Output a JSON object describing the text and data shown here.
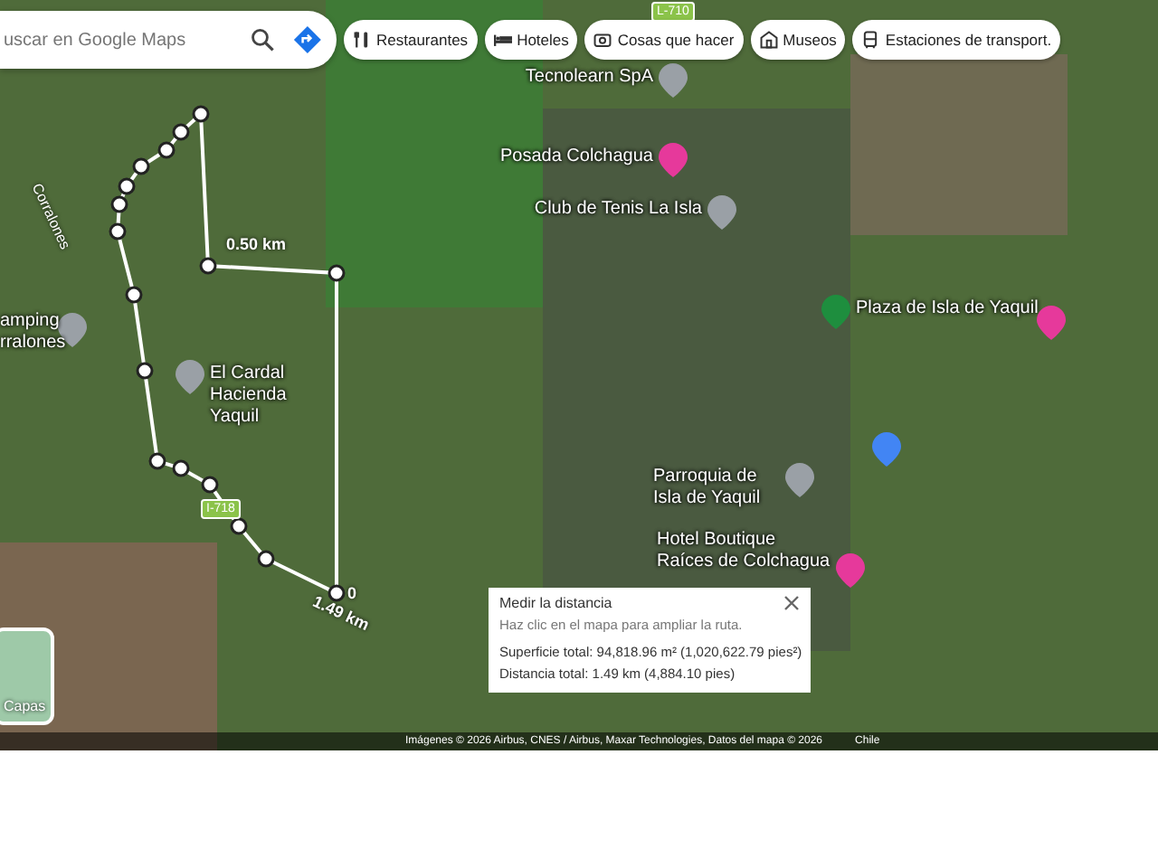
{
  "search": {
    "placeholder": "uscar en Google Maps"
  },
  "chips": [
    {
      "label": "Restaurantes"
    },
    {
      "label": "Hoteles"
    },
    {
      "label": "Cosas que hacer"
    },
    {
      "label": "Museos"
    },
    {
      "label": "Estaciones de transport."
    }
  ],
  "roads": [
    {
      "label": "L-710",
      "kind": "shield"
    },
    {
      "label": "I-718",
      "kind": "shield"
    },
    {
      "label": "Corralones",
      "kind": "street"
    }
  ],
  "places": [
    {
      "label": "Tecnolearn SpA",
      "color": "#9aa0a6"
    },
    {
      "label": "Posada Colchagua",
      "color": "#e6399b"
    },
    {
      "label": "Club de Tenis La Isla",
      "color": "#9aa0a6"
    },
    {
      "label": "Plaza de Isla de Yaquil",
      "color": "#1e8e3e"
    },
    {
      "color": "#e6399b"
    },
    {
      "label": "El Cardal Hacienda Yaquil",
      "color": "#9aa0a6"
    },
    {
      "label": "amping rralones",
      "color": "#9aa0a6"
    },
    {
      "label": "Parroquia de Isla de Yaquil",
      "color": "#9aa0a6"
    },
    {
      "color": "#4285f4"
    },
    {
      "label": "Hotel Boutique Raíces de Colchagua",
      "color": "#e6399b"
    }
  ],
  "measure_labels": [
    "0.50 km",
    "1.49 km",
    "0"
  ],
  "layers": {
    "label": "Capas"
  },
  "measure_panel": {
    "title": "Medir la distancia",
    "hint": "Haz clic en el mapa para ampliar la ruta.",
    "area": "Superficie total: 94,818.96 m² (1,020,622.79 pies²)",
    "distance": "Distancia total: 1.49 km (4,884.10 pies)"
  },
  "attribution": [
    "Imágenes © 2026 Airbus, CNES / Airbus, Maxar Technologies, Datos del mapa © 2026",
    "Chile"
  ]
}
